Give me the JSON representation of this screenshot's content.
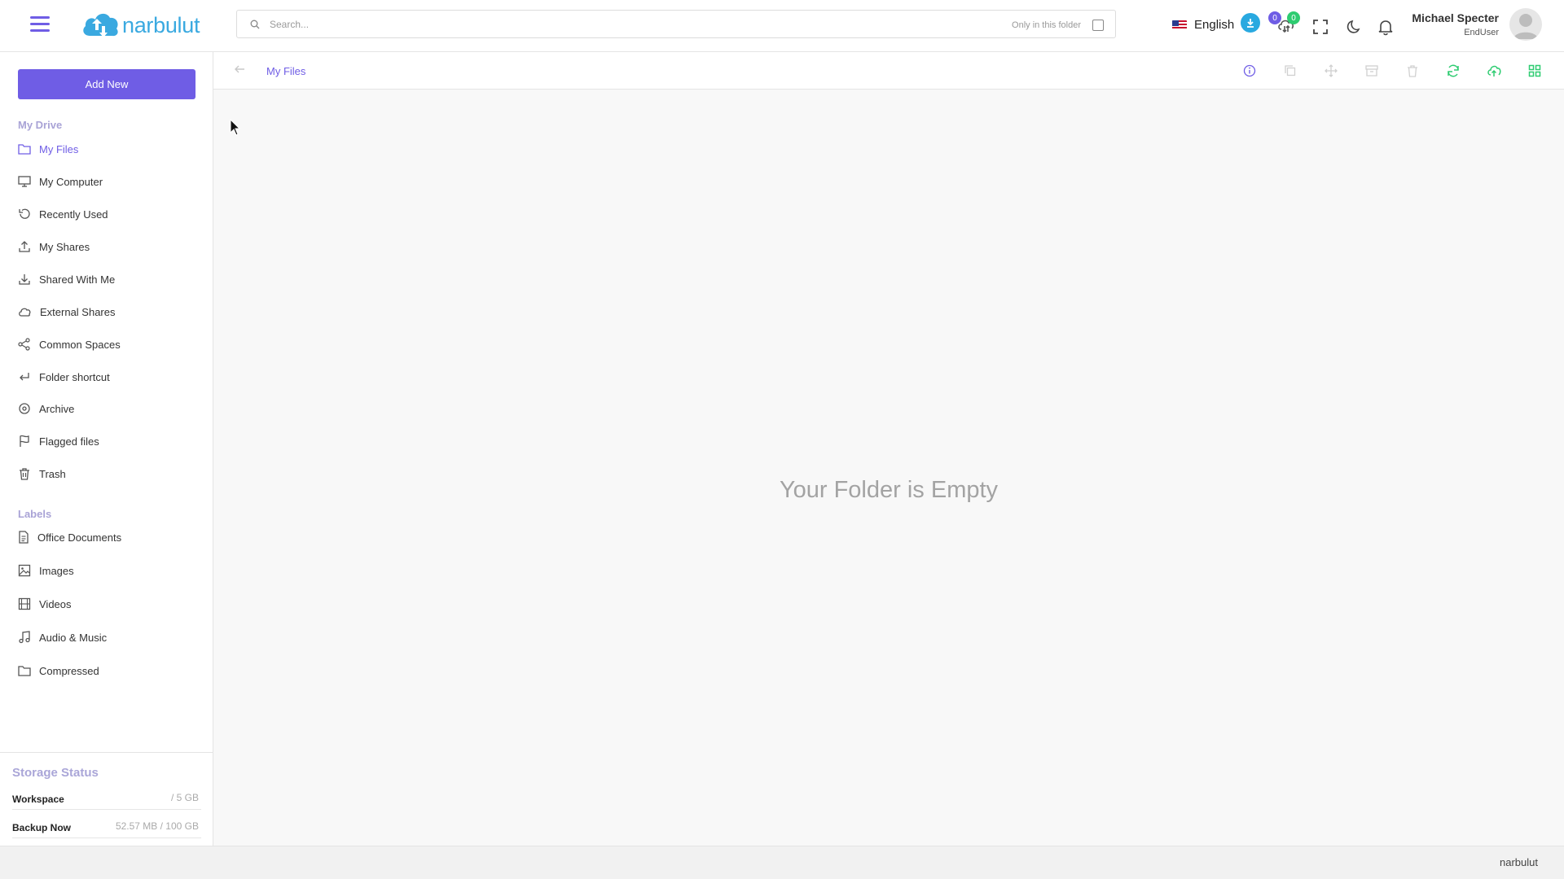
{
  "app": {
    "name": "narbulut"
  },
  "header": {
    "search_placeholder": "Search...",
    "only_in_folder": "Only in this folder",
    "language": "English",
    "badge_purple": "0",
    "badge_green": "0",
    "user_name": "Michael Specter",
    "user_role": "EndUser"
  },
  "sidebar": {
    "add_new": "Add New",
    "my_drive_label": "My Drive",
    "drive_items": [
      {
        "label": "My Files",
        "icon": "folder-icon"
      },
      {
        "label": "My Computer",
        "icon": "monitor-icon"
      },
      {
        "label": "Recently Used",
        "icon": "history-icon"
      },
      {
        "label": "My Shares",
        "icon": "upload-icon"
      },
      {
        "label": "Shared With Me",
        "icon": "download-icon"
      },
      {
        "label": "External Shares",
        "icon": "cloud-icon"
      },
      {
        "label": "Common Spaces",
        "icon": "share-icon"
      },
      {
        "label": "Folder shortcut",
        "icon": "return-arrow-icon"
      },
      {
        "label": "Archive",
        "icon": "disc-icon"
      },
      {
        "label": "Flagged files",
        "icon": "flag-icon"
      },
      {
        "label": "Trash",
        "icon": "trash-icon"
      }
    ],
    "labels_label": "Labels",
    "label_items": [
      {
        "label": "Office Documents",
        "icon": "document-icon"
      },
      {
        "label": "Images",
        "icon": "image-icon"
      },
      {
        "label": "Videos",
        "icon": "film-icon"
      },
      {
        "label": "Audio & Music",
        "icon": "music-icon"
      },
      {
        "label": "Compressed",
        "icon": "folder-icon"
      }
    ],
    "storage": {
      "title": "Storage Status",
      "rows": [
        {
          "name": "Workspace",
          "value": "/ 5 GB"
        },
        {
          "name": "Backup Now",
          "value": "52.57 MB / 100 GB"
        }
      ]
    }
  },
  "main": {
    "breadcrumb": "My Files",
    "empty_message": "Your Folder is Empty"
  },
  "footer": {
    "text": "narbulut"
  },
  "colors": {
    "accent": "#6f5de5",
    "brand_blue": "#3aa9e0",
    "green": "#2ecc71"
  }
}
